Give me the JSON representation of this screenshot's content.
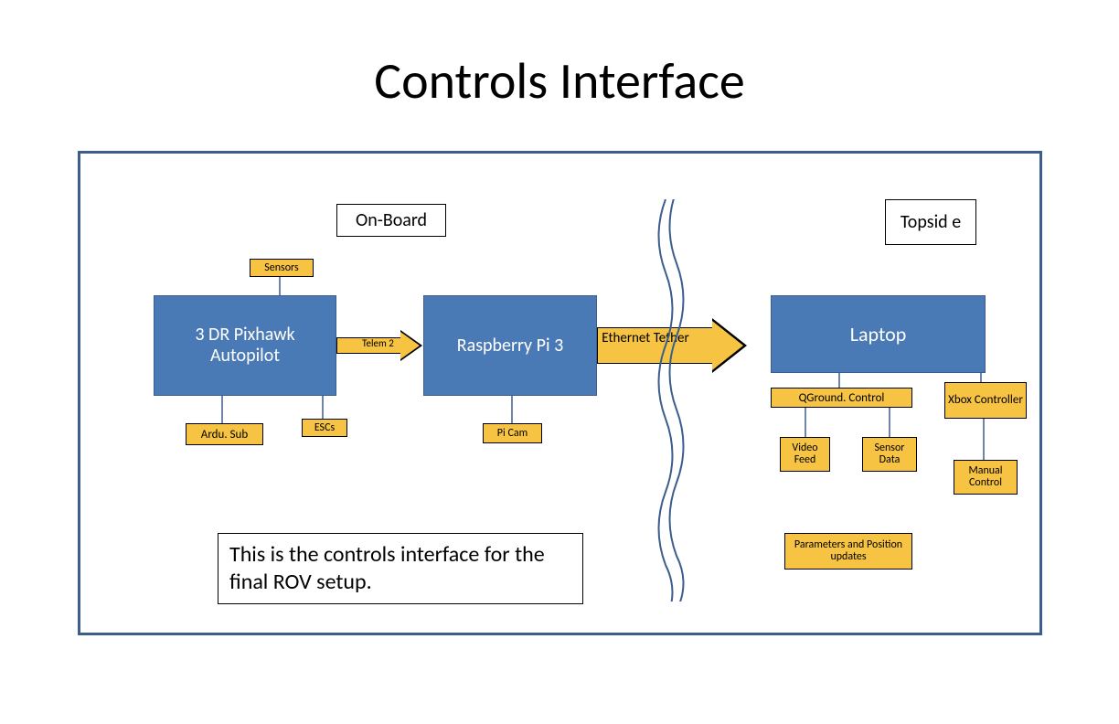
{
  "title": "Controls Interface",
  "labels": {
    "onboard": "On-Board",
    "topside": "Topsid e"
  },
  "blocks": {
    "pixhawk": "3 DR Pixhawk Autopilot",
    "raspi": "Raspberry Pi 3",
    "laptop": "Laptop"
  },
  "tags": {
    "sensors": "Sensors",
    "ardusub": "Ardu. Sub",
    "escs": "ESCs",
    "picam": "Pi Cam",
    "qgc": "QGround. Control",
    "xbox": "Xbox Controller",
    "videofeed": "Video Feed",
    "sensordata": "Sensor Data",
    "manual": "Manual Control",
    "params": "Parameters and Position updates"
  },
  "arrows": {
    "telem2": "Telem 2",
    "ethernet": "Ethernet Tether"
  },
  "caption": "This is the controls interface for the final ROV setup.",
  "colors": {
    "blue": "#4a7ab6",
    "blueBorder": "#3c5e8e",
    "yellow": "#f6c342"
  }
}
